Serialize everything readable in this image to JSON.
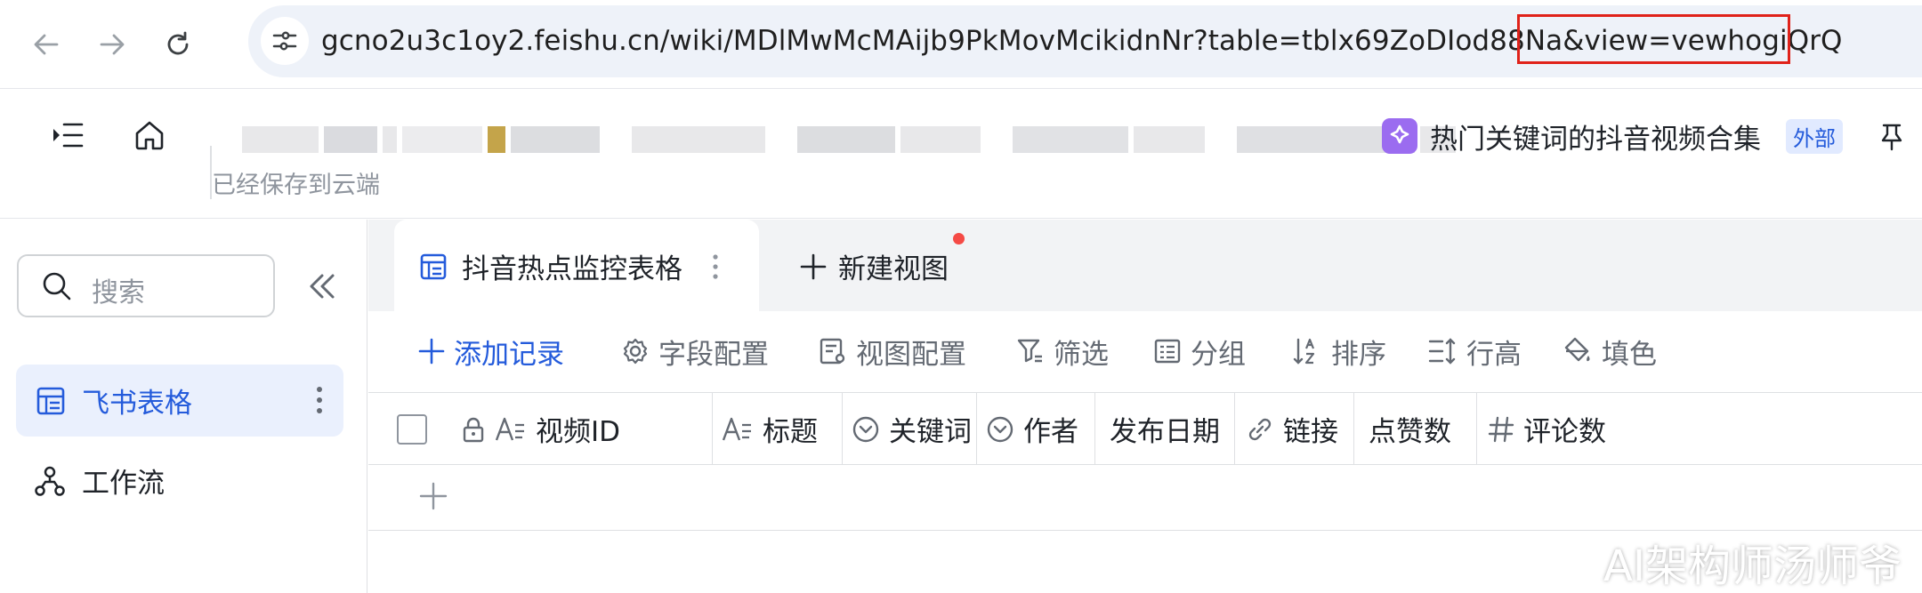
{
  "browser": {
    "url": "gcno2u3c1oy2.feishu.cn/wiki/MDlMwMcMAijb9PkMovMcikidnNr?table=tblx69ZoDIod88Na&view=vewhogiQrQ",
    "back_icon": "arrow-left-icon",
    "forward_icon": "arrow-right-icon",
    "reload_icon": "reload-icon",
    "site_info_icon": "tune-icon"
  },
  "doc_header": {
    "saved_status": "已经保存到云端",
    "title": "热门关键词的抖音视频合集",
    "external_badge": "外部",
    "title_icon_color": "#9b6cf0"
  },
  "sidebar": {
    "search_placeholder": "搜索",
    "items": [
      {
        "label": "飞书表格",
        "icon": "table-icon",
        "active": true
      },
      {
        "label": "工作流",
        "icon": "workflow-icon",
        "active": false
      }
    ]
  },
  "views": {
    "active_tab": "抖音热点监控表格",
    "new_view": "新建视图"
  },
  "toolbar": {
    "add_record": "添加记录",
    "field_config": "字段配置",
    "view_config": "视图配置",
    "filter": "筛选",
    "group": "分组",
    "sort": "排序",
    "row_height": "行高",
    "fill_color": "填色"
  },
  "columns": [
    {
      "label": "视频ID",
      "icon": "text-icon"
    },
    {
      "label": "标题",
      "icon": "text-icon"
    },
    {
      "label": "关键词",
      "icon": "single-select-icon"
    },
    {
      "label": "作者",
      "icon": "single-select-icon"
    },
    {
      "label": "发布日期",
      "icon": ""
    },
    {
      "label": "链接",
      "icon": "link-icon"
    },
    {
      "label": "点赞数",
      "icon": ""
    },
    {
      "label": "评论数",
      "icon": "number-icon"
    }
  ],
  "watermark": "AI架构师汤师爷",
  "colors": {
    "accent": "#245bdb",
    "highlight_box": "#e0221a",
    "notification_dot": "#f54a45"
  }
}
